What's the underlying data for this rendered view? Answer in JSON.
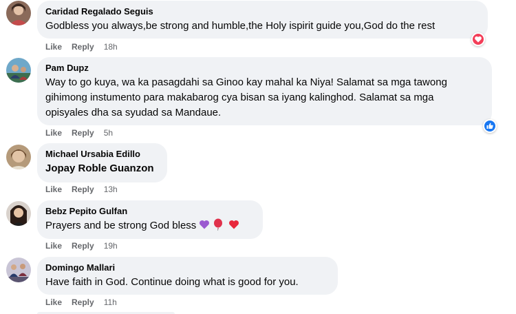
{
  "actions": {
    "like": "Like",
    "reply": "Reply"
  },
  "comments": [
    {
      "author": "Caridad Regalado Seguis",
      "lines": [
        "Godbless you always,be strong and humble,the Holy ispirit guide you,God do the rest"
      ],
      "time": "18h",
      "reaction": "love-reaction-icon"
    },
    {
      "author": "Pam Dupz",
      "lines": [
        "Way to go kuya, wa ka pasagdahi sa Ginoo kay mahal ka Niya! Salamat sa mga tawong",
        "gihimong instumento para makabarog cya bisan sa iyang kalinghod. Salamat sa mga",
        "opisyales dha sa syudad sa Mandaue."
      ],
      "time": "5h",
      "reaction": "like-reaction-icon"
    },
    {
      "author": "Michael Ursabia Edillo",
      "lines": [
        "Jopay Roble Guanzon"
      ],
      "time": "13h"
    },
    {
      "author": "Bebz Pepito Gulfan",
      "lines": [
        "Prayers and be strong God bless"
      ],
      "emojis": [
        "purple-heart-icon",
        "balloon-icon",
        "red-heart-icon"
      ],
      "time": "19h"
    },
    {
      "author": "Domingo Mallari",
      "lines": [
        "Have faith in God. Continue doing what is good for you."
      ],
      "time": "11h"
    }
  ],
  "colors": {
    "bubble": "#f0f2f5",
    "meta": "#65676b",
    "love": "#f33e58",
    "like": "#1877f2"
  }
}
